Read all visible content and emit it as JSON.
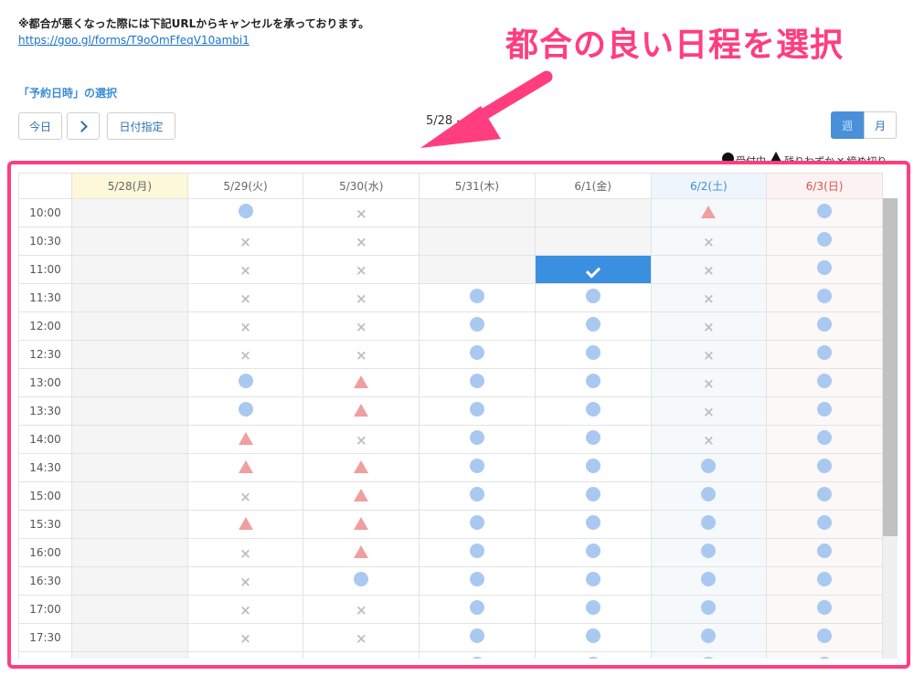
{
  "notice": {
    "text": "※都合が悪くなった際には下記URLからキャンセルを承っております。",
    "link": "https://goo.gl/forms/T9oOmFfeqV10ambi1"
  },
  "section_title": "「予約日時」の選択",
  "toolbar": {
    "today_label": "今日",
    "date_picker_label": "日付指定",
    "date_range": "5/28 - 6/3",
    "view_week_label": "週",
    "view_month_label": "月"
  },
  "legend": {
    "available": "受付中",
    "few_left": "残りわずか",
    "closed": "締め切り"
  },
  "calendar": {
    "days": [
      "5/28(月)",
      "5/29(火)",
      "5/30(水)",
      "5/31(木)",
      "6/1(金)",
      "6/2(土)",
      "6/3(日)"
    ],
    "day_types": [
      "today",
      "normal",
      "normal",
      "normal",
      "normal",
      "sat",
      "sun"
    ],
    "times": [
      "10:00",
      "10:30",
      "11:00",
      "11:30",
      "12:00",
      "12:30",
      "13:00",
      "13:30",
      "14:00",
      "14:30",
      "15:00",
      "15:30",
      "16:00",
      "16:30",
      "17:00",
      "17:30",
      ""
    ],
    "slots": [
      [
        "-",
        "o",
        "x",
        "-",
        "-",
        "t",
        "o"
      ],
      [
        "-",
        "x",
        "x",
        "-",
        "-",
        "x",
        "o"
      ],
      [
        "-",
        "x",
        "x",
        "-",
        "v",
        "x",
        "o"
      ],
      [
        "-",
        "x",
        "x",
        "o",
        "o",
        "x",
        "o"
      ],
      [
        "-",
        "x",
        "x",
        "o",
        "o",
        "x",
        "o"
      ],
      [
        "-",
        "x",
        "x",
        "o",
        "o",
        "x",
        "o"
      ],
      [
        "-",
        "o",
        "t",
        "o",
        "o",
        "x",
        "o"
      ],
      [
        "-",
        "o",
        "t",
        "o",
        "o",
        "x",
        "o"
      ],
      [
        "-",
        "t",
        "x",
        "o",
        "o",
        "x",
        "o"
      ],
      [
        "-",
        "t",
        "t",
        "o",
        "o",
        "o",
        "o"
      ],
      [
        "-",
        "x",
        "t",
        "o",
        "o",
        "o",
        "o"
      ],
      [
        "-",
        "t",
        "t",
        "o",
        "o",
        "o",
        "o"
      ],
      [
        "-",
        "x",
        "t",
        "o",
        "o",
        "o",
        "o"
      ],
      [
        "-",
        "x",
        "o",
        "o",
        "o",
        "o",
        "o"
      ],
      [
        "-",
        "x",
        "x",
        "o",
        "o",
        "o",
        "o"
      ],
      [
        "-",
        "x",
        "x",
        "o",
        "o",
        "o",
        "o"
      ],
      [
        "-",
        "x",
        "x",
        "o",
        "o",
        "o",
        "o"
      ]
    ]
  },
  "annotation": {
    "text": "都合の良い日程を選択",
    "color": "#ff3d7f"
  },
  "colors": {
    "selected": "#3a8fe0",
    "available": "#a9c9f0",
    "few_left": "#ef9f9f",
    "closed": "#bdbdbd"
  }
}
